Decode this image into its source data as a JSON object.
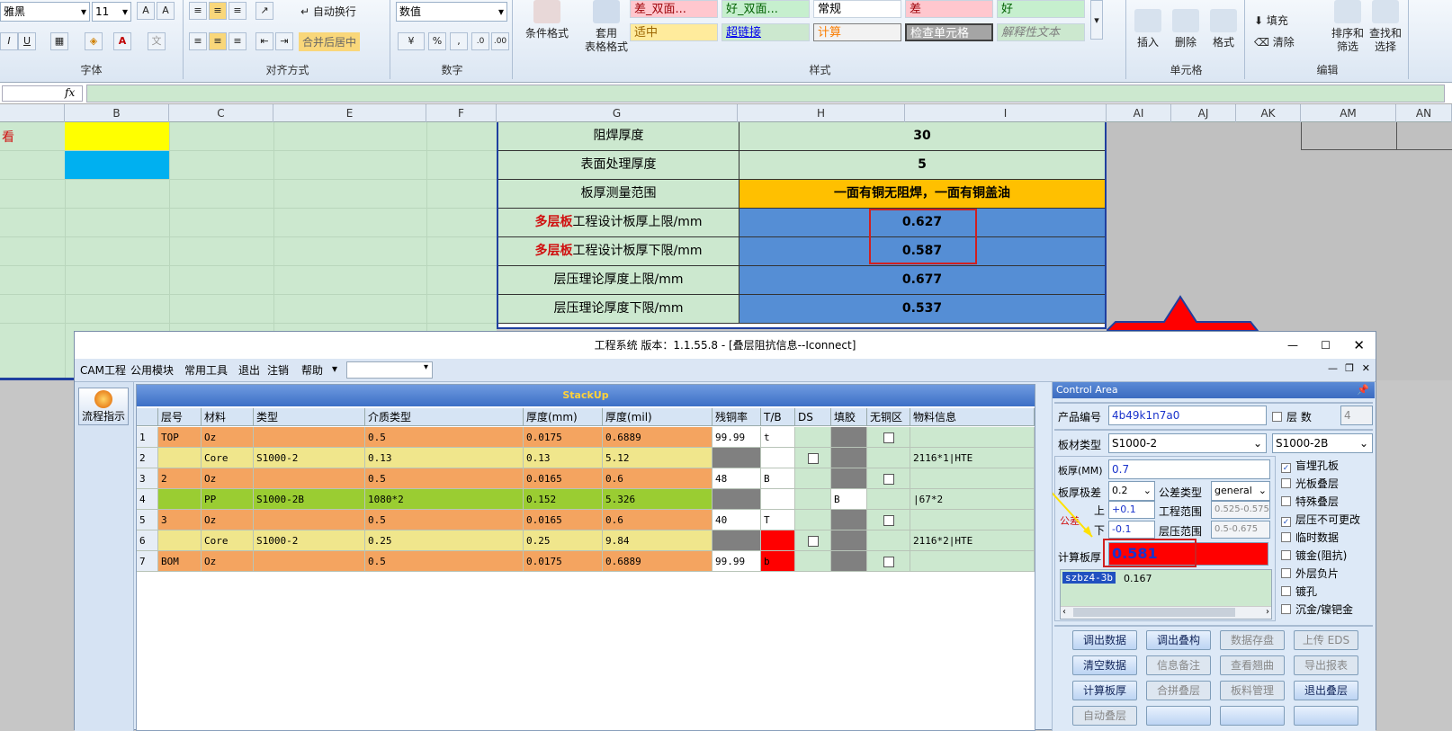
{
  "ribbon": {
    "font_name": "雅黑",
    "font_size": "11",
    "wrap_text": "自动换行",
    "merge_center": "合并后居中",
    "number_format": "数值",
    "group_font": "字体",
    "group_align": "对齐方式",
    "group_number": "数字",
    "group_styles": "样式",
    "group_cells": "单元格",
    "group_edit": "编辑",
    "cond_format": "条件格式",
    "table_format_1": "套用",
    "table_format_2": "表格格式",
    "styles": [
      "差_双面...",
      "好_双面...",
      "常规",
      "差",
      "好",
      "适中",
      "超链接",
      "计算",
      "检查单元格",
      "解释性文本"
    ],
    "insert": "插入",
    "delete": "删除",
    "format": "格式",
    "fill": "填充",
    "clear": "清除",
    "sort_1": "排序和",
    "sort_2": "筛选",
    "find_1": "查找和",
    "find_2": "选择",
    "bold": "B",
    "italic": "I",
    "underline": "U",
    "percent": "%",
    "comma": ","
  },
  "formula_bar": {
    "fx": "fx",
    "value": ""
  },
  "columns": [
    "B",
    "C",
    "E",
    "F",
    "G",
    "H",
    "I",
    "AI",
    "AJ",
    "AK",
    "AM",
    "AN"
  ],
  "sheet": {
    "a1_text": "看",
    "colors": {
      "yellow": "#ffff00",
      "cyan": "#00b0f0",
      "orange": "#ffc000",
      "blue": "#558ed5"
    },
    "rows": [
      {
        "label": "阻焊厚度",
        "value": "30"
      },
      {
        "label": "表面处理厚度",
        "value": "5"
      },
      {
        "label": "板厚测量范围",
        "value": "一面有铜无阻焊，一面有铜盖油"
      },
      {
        "label_red": "多层板",
        "label": "工程设计板厚上限/mm",
        "value": "0.627"
      },
      {
        "label_red": "多层板",
        "label": "工程设计板厚下限/mm",
        "value": "0.587"
      },
      {
        "label": "层压理论厚度上限/mm",
        "value": "0.677"
      },
      {
        "label": "层压理论厚度下限/mm",
        "value": "0.537"
      }
    ]
  },
  "window": {
    "title": "工程系统   版本：1.1.55.8 - [叠层阻抗信息--Iconnect]",
    "menu": [
      "CAM工程",
      "公用模块",
      "常用工具",
      "退出",
      "注销",
      "帮助"
    ],
    "sidebar_button": "流程指示",
    "stackup_title": "StackUp",
    "headers": [
      "层号",
      "材料",
      "类型",
      "介质类型",
      "厚度(mm)",
      "厚度(mil)",
      "残铜率",
      "T/B",
      "DS",
      "填胶",
      "无铜区",
      "物料信息"
    ],
    "rows": [
      {
        "n": "1",
        "layer": "TOP",
        "mat": "Oz",
        "type": "",
        "diel": "0.5",
        "mm": "0.0175",
        "mil": "0.6889",
        "res": "99.99",
        "tb": "t",
        "ds": "",
        "fill": "",
        "nocu": "box",
        "info": ""
      },
      {
        "n": "2",
        "layer": "",
        "mat": "Core",
        "type": "S1000-2",
        "diel": "0.13",
        "mm": "0.13",
        "mil": "5.12",
        "res": "",
        "tb": "",
        "ds": "box",
        "fill": "",
        "nocu": "",
        "info": "2116*1|HTE"
      },
      {
        "n": "3",
        "layer": "2",
        "mat": "Oz",
        "type": "",
        "diel": "0.5",
        "mm": "0.0165",
        "mil": "0.6",
        "res": "48",
        "tb": "B",
        "ds": "",
        "fill": "",
        "nocu": "box",
        "info": ""
      },
      {
        "n": "4",
        "layer": "",
        "mat": "PP",
        "type": "S1000-2B",
        "diel": "1080*2",
        "mm": "0.152",
        "mil": "5.326",
        "res": "",
        "tb": "",
        "ds": "",
        "fill": "B",
        "nocu": "",
        "info": "|67*2"
      },
      {
        "n": "5",
        "layer": "3",
        "mat": "Oz",
        "type": "",
        "diel": "0.5",
        "mm": "0.0165",
        "mil": "0.6",
        "res": "40",
        "tb": "T",
        "ds": "",
        "fill": "",
        "nocu": "box",
        "info": ""
      },
      {
        "n": "6",
        "layer": "",
        "mat": "Core",
        "type": "S1000-2",
        "diel": "0.25",
        "mm": "0.25",
        "mil": "9.84",
        "res": "",
        "tb": "",
        "ds": "box",
        "fill": "",
        "nocu": "",
        "info": "2116*2|HTE"
      },
      {
        "n": "7",
        "layer": "BOM",
        "mat": "Oz",
        "type": "",
        "diel": "0.5",
        "mm": "0.0175",
        "mil": "0.6889",
        "res": "99.99",
        "tb": "b",
        "ds": "",
        "fill": "",
        "nocu": "box",
        "info": ""
      }
    ],
    "control": {
      "title": "Control Area",
      "product_label": "产品编号",
      "product": "4b49k1n7a0",
      "layers_label": "层  数",
      "layers": "4",
      "board_type_label": "板材类型",
      "board_type": "S1000-2",
      "board_type2": "S1000-2B",
      "thickness_label": "板厚(MM)",
      "thickness": "0.7",
      "tol_label": "板厚极差",
      "tol": "0.2",
      "tol_type_label": "公差类型",
      "tol_type": "general",
      "tol_side": "公差",
      "up_label": "上",
      "down_label": "下",
      "up": "+0.1",
      "down": "-0.1",
      "eng_range_label": "工程范围",
      "eng_range": "0.525-0.575",
      "press_range_label": "层压范围",
      "press_range": "0.5-0.675",
      "calc_label": "计算板厚",
      "calc_value": "0.581",
      "list": [
        {
          "name": "szbz4-3b",
          "value": "0.167"
        }
      ],
      "checks": [
        {
          "label": "盲埋孔板",
          "checked": true
        },
        {
          "label": "光板叠层",
          "checked": false
        },
        {
          "label": "特殊叠层",
          "checked": false
        },
        {
          "label": "层压不可更改",
          "checked": true
        },
        {
          "label": "临时数据",
          "checked": false
        },
        {
          "label": "镀金(阻抗)",
          "checked": false
        },
        {
          "label": "外层负片",
          "checked": false
        },
        {
          "label": "镀孔",
          "checked": false
        },
        {
          "label": "沉金/镍钯金",
          "checked": false
        }
      ],
      "buttons": [
        {
          "label": "调出数据",
          "on": true
        },
        {
          "label": "调出叠构",
          "on": true
        },
        {
          "label": "数据存盘",
          "on": false
        },
        {
          "label": "上传 EDS",
          "on": false
        },
        {
          "label": "清空数据",
          "on": true
        },
        {
          "label": "信息备注",
          "on": false
        },
        {
          "label": "查看翘曲",
          "on": false
        },
        {
          "label": "导出报表",
          "on": false
        },
        {
          "label": "计算板厚",
          "on": true
        },
        {
          "label": "合拼叠层",
          "on": false
        },
        {
          "label": "板料管理",
          "on": false
        },
        {
          "label": "退出叠层",
          "on": true
        },
        {
          "label": "自动叠层",
          "on": false
        },
        {
          "label": "",
          "on": true
        },
        {
          "label": "",
          "on": true
        },
        {
          "label": "",
          "on": true
        }
      ]
    }
  }
}
